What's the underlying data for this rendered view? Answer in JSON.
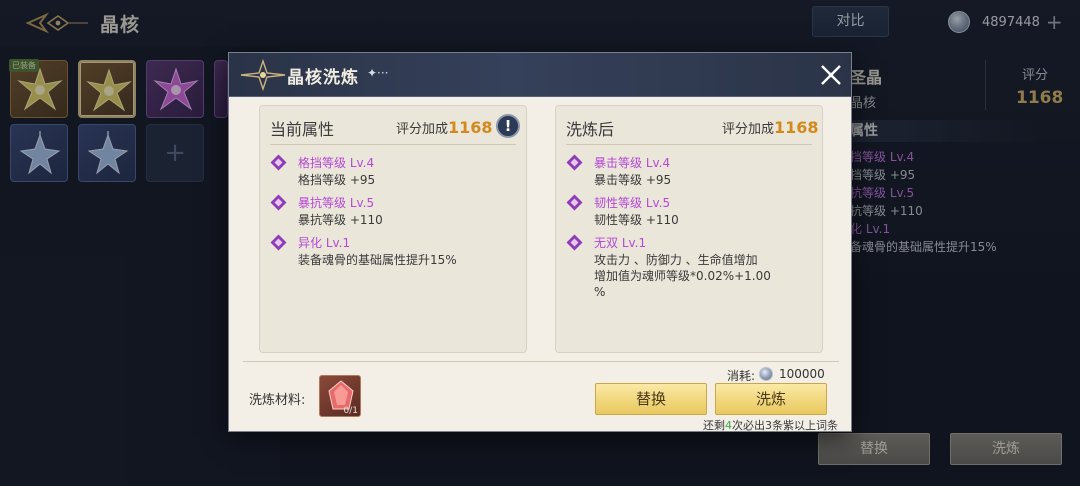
{
  "header": {
    "title": "晶核",
    "compare_label": "对比",
    "currency_value": "4897448"
  },
  "inventory": {
    "equipped_tag": "已装备"
  },
  "detail": {
    "name": "圣晶",
    "subtitle": "晶核",
    "score_label": "评分",
    "score_value": "1168",
    "section_title": "属性",
    "lines": [
      {
        "text": "挡等级 Lv.4",
        "color": "purple"
      },
      {
        "text": "挡等级  +95",
        "color": "white"
      },
      {
        "text": "抗等级 Lv.5",
        "color": "purple"
      },
      {
        "text": "抗等级  +110",
        "color": "white"
      },
      {
        "text": "化 Lv.1",
        "color": "purple"
      },
      {
        "text": "备魂骨的基础属性提升15%",
        "color": "white"
      }
    ],
    "replace_label": "替换",
    "refine_label": "洗炼"
  },
  "modal": {
    "title": "晶核洗炼",
    "title_deco": "✦···",
    "current": {
      "header": "当前属性",
      "score_label": "评分加成",
      "score_value": "1168",
      "warn": "!",
      "attributes": [
        {
          "title": "格挡等级 Lv.4",
          "desc": "格挡等级  +95"
        },
        {
          "title": "暴抗等级 Lv.5",
          "desc": "暴抗等级  +110"
        },
        {
          "title": "异化 Lv.1",
          "desc": "装备魂骨的基础属性提升15%"
        }
      ]
    },
    "after": {
      "header": "洗炼后",
      "score_label": "评分加成",
      "score_value": "1168",
      "attributes": [
        {
          "title": "暴击等级 Lv.4",
          "desc": "暴击等级  +95"
        },
        {
          "title": "韧性等级 Lv.5",
          "desc": "韧性等级  +110"
        },
        {
          "title": "无双 Lv.1",
          "desc": "攻击力 、防御力 、生命值增加\n增加值为魂师等级*0.02%+1.00\n%"
        }
      ]
    },
    "material_label": "洗炼材料:",
    "material_count": "0/1",
    "cost_label": "消耗:",
    "cost_value": "100000",
    "replace_label": "替换",
    "refine_label": "洗炼",
    "note_prefix": "还剩",
    "note_number": "4",
    "note_suffix": "次必出3条紫以上词条"
  }
}
